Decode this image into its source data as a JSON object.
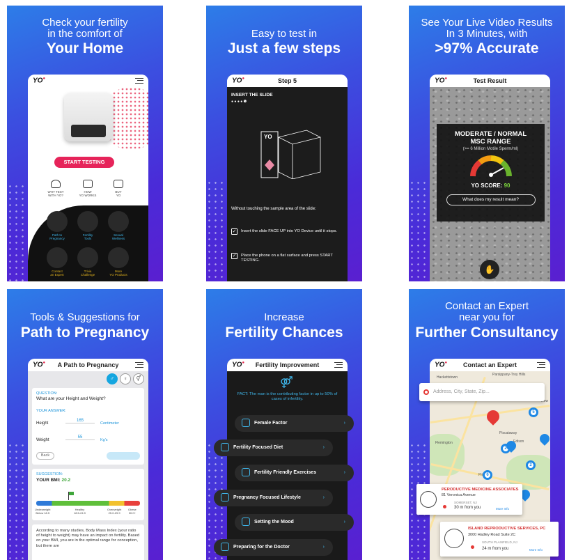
{
  "panels": [
    {
      "headline1": "Check your fertility",
      "headline2": "in the comfort of",
      "headline3": "Your Home",
      "logo": "YO",
      "start_button": "START TESTING",
      "mini_links": [
        {
          "label1": "WHY TEST",
          "label2": "WITH YO?"
        },
        {
          "label1": "HOW",
          "label2": "YO WORKS"
        },
        {
          "label1": "BUY",
          "label2": "YO"
        }
      ],
      "tiles": [
        {
          "label1": "Path to",
          "label2": "Pregnancy",
          "color": "#3fb6ea"
        },
        {
          "label1": "Fertility",
          "label2": "Tools",
          "color": "#3fb6ea"
        },
        {
          "label1": "Sexual",
          "label2": "Wellness",
          "color": "#3fb6ea"
        },
        {
          "label1": "Contact",
          "label2": "an Expert",
          "color": "#e0b21e"
        },
        {
          "label1": "Trivia",
          "label2": "Challenge",
          "color": "#e0b21e"
        },
        {
          "label1": "More",
          "label2": "YO Products",
          "color": "#e0b21e"
        }
      ]
    },
    {
      "headline1": "Easy to test in",
      "headline2": "Just a few steps",
      "title": "Step 5",
      "step_heading": "INSERT THE SLIDE",
      "step_dots": "● ● ● ● ❺",
      "instruction": "Without touching the sample area of the slide:",
      "checks": [
        "Insert the slide FACE UP into YO Device until it stops.",
        "Place the phone on a flat surface and press START TESTING."
      ]
    },
    {
      "headline1": "See Your Live Video Results",
      "headline2": "In 3 Minutes, with",
      "headline3": ">97% Accurate",
      "title": "Test Result",
      "result_line1": "MODERATE / NORMAL",
      "result_line2": "MSC RANGE",
      "result_sub": "(>= 6 Million Motile Sperm/ml)",
      "score_label": "YO SCORE:",
      "score_value": "90",
      "help_button": "What does my result mean?"
    },
    {
      "headline1": "Tools & Suggestions for",
      "headline2": "Path to Pregnancy",
      "title": "A Path to Pregnancy",
      "gender_icons": [
        "♂",
        "♀",
        "⚥"
      ],
      "question_label": "QUESTION:",
      "question": "What are your Height and Weight?",
      "answer_label": "YOUR ANSWER:",
      "height_label": "Height",
      "height_value": "165",
      "height_unit": "Centimeter",
      "weight_label": "Weight",
      "weight_value": "55",
      "weight_unit": "Kg's",
      "back_button": "Back",
      "suggestion_label": "SUGGESTION:",
      "bmi_label": "YOUR BMI:",
      "bmi_value": "20.2",
      "bmi_ranges": [
        {
          "label1": "Underweight",
          "label2": "Below 18.5"
        },
        {
          "label1": "Healthy",
          "label2": "18.5-24.9"
        },
        {
          "label1": "Overweight",
          "label2": "25.0-29.9"
        },
        {
          "label1": "Obese",
          "label2": "30.0+"
        }
      ],
      "body_text": "According to many studies, Body Mass Index (your ratio of height to weight) may have an impact on fertility. Based on your BMI, you are in the optimal range for conception, but there are"
    },
    {
      "headline1": "Increase",
      "headline2": "Fertility Chances",
      "title": "Fertility Improvement",
      "fact": "FACT: The man is the contributing factor in up to 50% of cases of infertility.",
      "items": [
        "Female Factor",
        "Fertility Focused Diet",
        "Fertility Friendly Exercises",
        "Pregnancy Focused Lifestyle",
        "Setting the Mood",
        "Preparing for the Doctor"
      ]
    },
    {
      "headline1": "Contact an Expert",
      "headline2": "near you for",
      "headline3": "Further Consultancy",
      "title": "Contact an Expert",
      "search_placeholder": "Address, City, State, Zip...",
      "towns": [
        "Hackettstown",
        "Parsippany-Troy Hills",
        "New",
        "Flemington",
        "Piscataway",
        "Edison",
        "Prin"
      ],
      "clusters": [
        "6",
        "2",
        "2",
        "5"
      ],
      "card1": {
        "name": "PERODUCTIVE MEDICINE ASSOCIATES",
        "address": "81 Veronica Avenue",
        "city": "SOMERSET, NJ",
        "distance": "30 m from you",
        "more": "More Info"
      },
      "card2": {
        "name": "ISLAND REPRODUCTIVE SERVICES, PC",
        "address": "3000 Hadley Road Suite 2C",
        "city": "SOUTH PLAINFIELD, NJ",
        "distance": "24 m from you",
        "more": "More Info"
      }
    }
  ]
}
